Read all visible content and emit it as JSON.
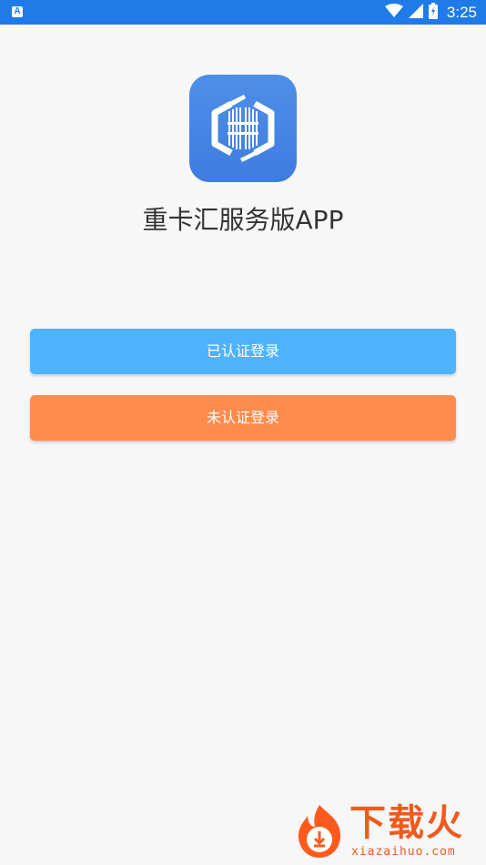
{
  "status_bar": {
    "time": "3:25",
    "left_icon": "a-notification-icon",
    "icons": [
      "wifi-icon",
      "cellular-signal-icon",
      "battery-icon"
    ],
    "background": "#1f7be8"
  },
  "app": {
    "icon": "app-logo-icon",
    "title": "重卡汇服务版APP"
  },
  "buttons": {
    "certified_login": "已认证登录",
    "uncertified_login": "未认证登录"
  },
  "colors": {
    "certified_button": "#4fb2fc",
    "uncertified_button": "#ff8b4c",
    "icon_background": "#3e7ce0"
  },
  "watermark": {
    "brand": "下载火",
    "url": "xiazaihuo.com",
    "icon": "flame-download-icon"
  }
}
